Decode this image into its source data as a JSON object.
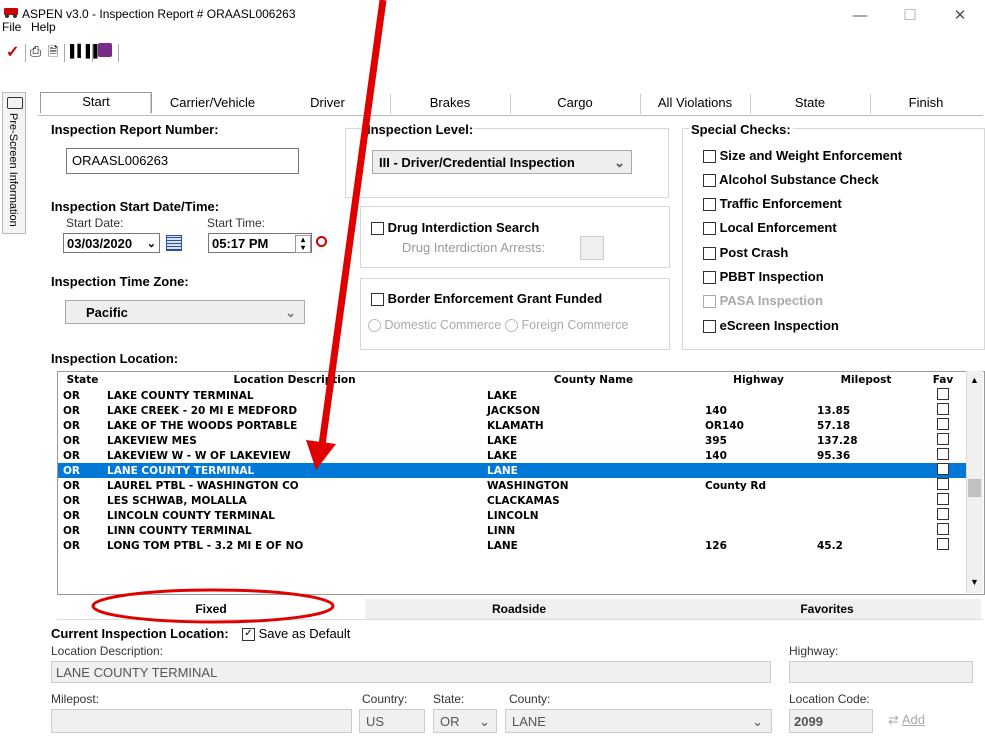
{
  "window": {
    "title": "ASPEN v3.0 - Inspection Report # ORAASL006263",
    "minimize": "—",
    "maximize": "☐",
    "close": "✕"
  },
  "menu": [
    "File",
    "Help"
  ],
  "toolbar": {
    "icons": [
      "check-icon",
      "print-icon",
      "print-preview-icon",
      "barcode-icon",
      "book-icon"
    ]
  },
  "sidebar": {
    "label": "Pre-Screen Information"
  },
  "tabs": [
    "Start",
    "Carrier/Vehicle",
    "Driver",
    "Brakes",
    "Cargo",
    "All Violations",
    "State",
    "Finish"
  ],
  "report": {
    "number_label": "Inspection Report Number:",
    "number": "ORAASL006263",
    "level_label": "Inspection Level:",
    "level": "III - Driver/Credential Inspection",
    "start_label": "Inspection Start Date/Time:",
    "start_date_label": "Start Date:",
    "start_date": "03/03/2020",
    "start_time_label": "Start Time:",
    "start_time": "05:17 PM",
    "timezone_label": "Inspection Time Zone:",
    "timezone": "Pacific"
  },
  "drug": {
    "label": "Drug Interdiction Search",
    "arrests_label": "Drug Interdiction Arrests:"
  },
  "border": {
    "label": "Border Enforcement Grant Funded",
    "domestic": "Domestic Commerce",
    "foreign": "Foreign Commerce"
  },
  "special": {
    "title": "Special Checks:",
    "items": [
      "Size and Weight Enforcement",
      "Alcohol Substance Check",
      "Traffic Enforcement",
      "Local Enforcement",
      "Post Crash",
      "PBBT Inspection",
      "PASA Inspection",
      "eScreen Inspection"
    ]
  },
  "location": {
    "title": "Inspection Location:",
    "columns": [
      "State",
      "Location Description",
      "County Name",
      "Highway",
      "Milepost",
      "Fav"
    ],
    "rows": [
      [
        "OR",
        "LAKE COUNTY TERMINAL",
        "LAKE",
        "",
        ""
      ],
      [
        "OR",
        "LAKE CREEK - 20 MI E MEDFORD",
        "JACKSON",
        "140",
        "13.85"
      ],
      [
        "OR",
        "LAKE OF THE WOODS PORTABLE",
        "KLAMATH",
        "OR140",
        "57.18"
      ],
      [
        "OR",
        "LAKEVIEW MES",
        "LAKE",
        "395",
        "137.28"
      ],
      [
        "OR",
        "LAKEVIEW W - W OF LAKEVIEW",
        "LAKE",
        "140",
        "95.36"
      ],
      [
        "OR",
        "LANE COUNTY TERMINAL",
        "LANE",
        "",
        ""
      ],
      [
        "OR",
        "LAUREL PTBL - WASHINGTON CO",
        "WASHINGTON",
        "County Rd",
        ""
      ],
      [
        "OR",
        "LES SCHWAB, MOLALLA",
        "CLACKAMAS",
        "",
        ""
      ],
      [
        "OR",
        "LINCOLN COUNTY TERMINAL",
        "LINCOLN",
        "",
        ""
      ],
      [
        "OR",
        "LINN COUNTY TERMINAL",
        "LINN",
        "",
        ""
      ],
      [
        "OR",
        "LONG TOM PTBL - 3.2 MI E OF NO",
        "LANE",
        "126",
        "45.2"
      ]
    ],
    "selected_row": "LANE COUNTY TERMINAL",
    "subtabs": [
      "Fixed",
      "Roadside",
      "Favorites"
    ]
  },
  "current": {
    "title": "Current Inspection Location:",
    "save_default": "Save as Default",
    "desc_label": "Location Description:",
    "desc": "LANE COUNTY TERMINAL",
    "highway_label": "Highway:",
    "milepost_label": "Milepost:",
    "country_label": "Country:",
    "country": "US",
    "state_label": "State:",
    "state": "OR",
    "county_label": "County:",
    "county": "LANE",
    "code_label": "Location Code:",
    "code": "2099",
    "add": "Add"
  },
  "colors": {
    "selection": "#0078d7",
    "annotation": "#e00000"
  }
}
